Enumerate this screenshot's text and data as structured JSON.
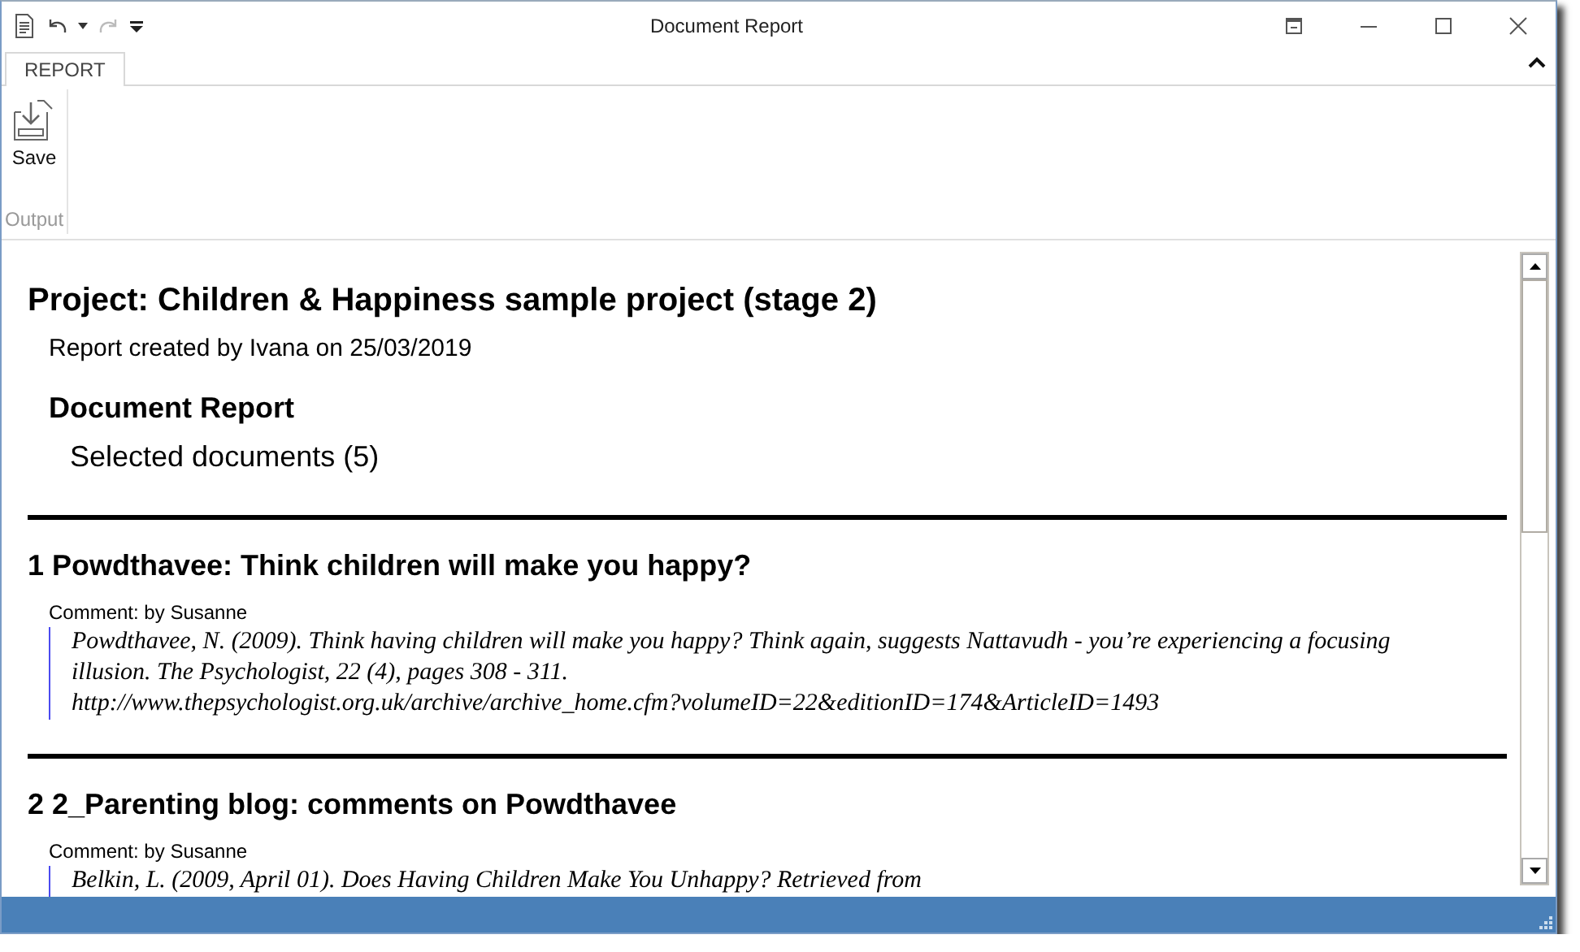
{
  "window": {
    "title": "Document Report"
  },
  "tabs": [
    {
      "label": "REPORT",
      "selected": true
    }
  ],
  "ribbon_groups": [
    {
      "label": "Output",
      "buttons": [
        {
          "label": "Save"
        }
      ]
    }
  ],
  "report": {
    "title": "Project: Children & Happiness sample project (stage 2)",
    "created": "Report created by Ivana on 25/03/2019",
    "heading": "Document Report",
    "selection": "Selected documents (5)",
    "documents": [
      {
        "heading": "1 Powdthavee: Think children will make you happy?",
        "comment": "Comment: by Susanne",
        "citation": [
          "Powdthavee, N. (2009). Think having children will make you happy? Think again, suggests Nattavudh - you’re experiencing a focusing illusion. The Psychologist, 22 (4), pages 308 - 311.",
          "http://www.thepsychologist.org.uk/archive/archive_home.cfm?volumeID=22&editionID=174&ArticleID=1493"
        ]
      },
      {
        "heading": "2 2_Parenting blog: comments on Powdthavee",
        "comment": "Comment: by Susanne",
        "citation": [
          "Belkin, L. (2009, April 01). Does Having Children Make You Unhappy? Retrieved from"
        ]
      }
    ]
  }
}
